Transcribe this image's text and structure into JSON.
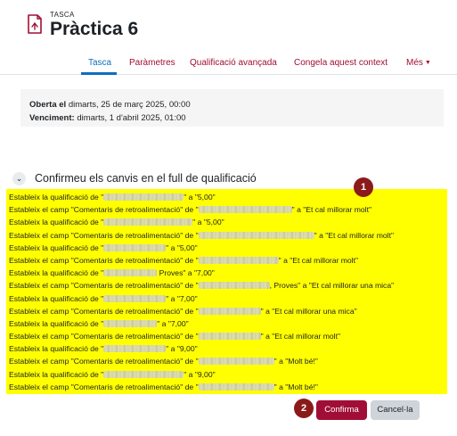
{
  "header": {
    "module_type": "TASCA",
    "title": "Pràctica 6",
    "icon": "assignment-icon",
    "accent": "#a10e35"
  },
  "tabs": [
    {
      "label": "Tasca",
      "active": true
    },
    {
      "label": "Paràmetres"
    },
    {
      "label": "Qualificació avançada"
    },
    {
      "label": "Congela aquest context"
    },
    {
      "label": "Més"
    }
  ],
  "dates": {
    "open_label": "Oberta el",
    "open_value": "dimarts, 25 de març 2025, 00:00",
    "due_label": "Venciment:",
    "due_value": "dimarts, 1 d'abril 2025, 01:00"
  },
  "confirm": {
    "title": "Confirmeu els canvis en el full de qualificació",
    "highlight": "#ffff00",
    "lines": [
      {
        "pre": "Estableix la qualificació de \"",
        "post": "\" a \"5,00\""
      },
      {
        "pre": "Estableix el camp \"Comentaris de retroalimentació\" de \"",
        "post": "\" a \"Et cal millorar molt\""
      },
      {
        "pre": "Estableix la qualificació de \"",
        "post": "\" a \"5,00\""
      },
      {
        "pre": "Estableix el camp \"Comentaris de retroalimentació\" de \"",
        "post": "\" a \"Et cal millorar molt\""
      },
      {
        "pre": "Estableix la qualificació de \"",
        "post": "\" a \"5,00\""
      },
      {
        "pre": "Estableix el camp \"Comentaris de retroalimentació\" de \"",
        "post": "\" a \"Et cal millorar molt\""
      },
      {
        "pre": "Estableix la qualificació de \"",
        "post": " Proves\" a \"7,00\""
      },
      {
        "pre": "Estableix el camp \"Comentaris de retroalimentació\" de \"",
        "post": ", Proves\" a \"Et cal millorar una mica\""
      },
      {
        "pre": "Estableix la qualificació de \"",
        "post": "\" a \"7,00\""
      },
      {
        "pre": "Estableix el camp \"Comentaris de retroalimentació\" de \"",
        "post": "\" a \"Et cal millorar una mica\""
      },
      {
        "pre": "Estableix la qualificació de \"",
        "post": "\" a \"7,00\""
      },
      {
        "pre": "Estableix el camp \"Comentaris de retroalimentació\" de \"",
        "post": "\" a \"Et cal millorar molt\""
      },
      {
        "pre": "Estableix la qualificació de \"",
        "post": "\" a \"9,00\""
      },
      {
        "pre": "Estableix el camp \"Comentaris de retroalimentació\" de \"",
        "post": "\" a \"Molt bé!\""
      },
      {
        "pre": "Estableix la qualificació de \"",
        "post": "\" a \"9,00\""
      },
      {
        "pre": "Estableix el camp \"Comentaris de retroalimentació\" de \"",
        "post": "\" a \"Molt bé!\""
      }
    ]
  },
  "badges": {
    "first": "1",
    "second": "2",
    "color": "#8b1a1a"
  },
  "actions": {
    "confirm_label": "Confirma",
    "cancel_label": "Cancel·la"
  }
}
